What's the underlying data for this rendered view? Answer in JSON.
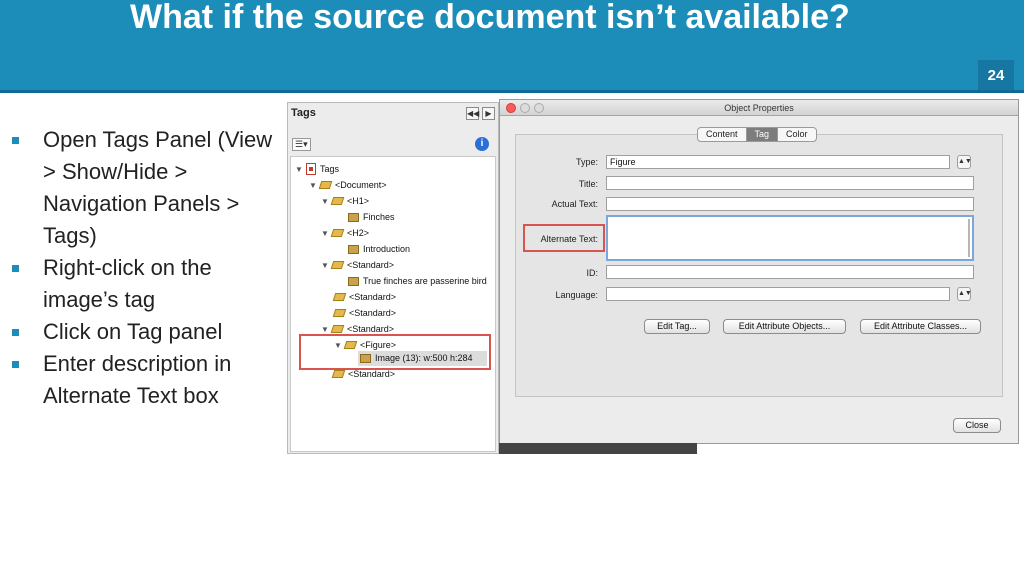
{
  "slide": {
    "title": "What if the source document isn’t available?",
    "page_number": "24",
    "bullets": [
      "Open Tags Panel (View > Show/Hide > Navigation Panels > Tags)",
      "Right-click on the image’s tag",
      "Click on Tag panel",
      "Enter description in Alternate Text box"
    ]
  },
  "tags_panel": {
    "title": "Tags",
    "options_label": "☰▾",
    "tree": [
      {
        "label": "Tags",
        "icon": "pdf-icon"
      },
      {
        "label": "<Document>",
        "icon": "tag-icon"
      },
      {
        "label": "<H1>",
        "icon": "tag-icon"
      },
      {
        "label": "Finches",
        "icon": "content-icon"
      },
      {
        "label": "<H2>",
        "icon": "tag-icon"
      },
      {
        "label": "Introduction",
        "icon": "content-icon"
      },
      {
        "label": "<Standard>",
        "icon": "tag-icon"
      },
      {
        "label": "True finches are passerine bird",
        "icon": "content-icon"
      },
      {
        "label": "<Standard>",
        "icon": "tag-icon"
      },
      {
        "label": "<Standard>",
        "icon": "tag-icon"
      },
      {
        "label": "<Standard>",
        "icon": "tag-icon"
      },
      {
        "label": "<Figure>",
        "icon": "tag-icon"
      },
      {
        "label": "Image (13): w:500 h:284",
        "icon": "content-icon"
      },
      {
        "label": "<Standard>",
        "icon": "tag-icon"
      }
    ]
  },
  "dialog": {
    "title": "Object Properties",
    "tabs": [
      "Content",
      "Tag",
      "Color"
    ],
    "active_tab": "Tag",
    "fields": {
      "type_label": "Type:",
      "type_value": "Figure",
      "title_label": "Title:",
      "title_value": "",
      "actual_text_label": "Actual Text:",
      "actual_text_value": "",
      "alternate_text_label": "Alternate Text:",
      "alternate_text_value": "",
      "id_label": "ID:",
      "id_value": "",
      "language_label": "Language:",
      "language_value": ""
    },
    "buttons": {
      "edit_tag": "Edit Tag...",
      "edit_attribute_objects": "Edit Attribute Objects...",
      "edit_attribute_classes": "Edit Attribute Classes...",
      "close": "Close"
    }
  },
  "colors": {
    "header": "#1c8cb8",
    "highlight": "#d9534f"
  }
}
